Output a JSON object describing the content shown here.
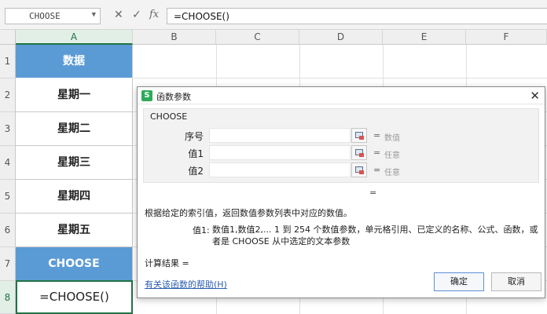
{
  "formula_bar": {
    "name_box": "CHOOSE",
    "cancel_icon": "✕",
    "enter_icon": "✓",
    "fx_label": "fx",
    "formula": "=CHOOSE()"
  },
  "columns": [
    "A",
    "B",
    "C",
    "D",
    "E",
    "F"
  ],
  "rows": [
    "1",
    "2",
    "3",
    "4",
    "5",
    "6",
    "7",
    "8"
  ],
  "cells": {
    "a1": "数据",
    "a2": "星期一",
    "a3": "星期二",
    "a4": "星期三",
    "a5": "星期四",
    "a6": "星期五",
    "a7": "CHOOSE",
    "a8": "=CHOOSE()"
  },
  "colors": {
    "header_blue": "#5b9bd5",
    "selection_green": "#217346"
  },
  "dialog": {
    "app_icon": "S",
    "title": "函数参数",
    "close": "✕",
    "function_name": "CHOOSE",
    "args": [
      {
        "label": "序号",
        "value": "",
        "hint": "数值"
      },
      {
        "label": "值1",
        "value": "",
        "hint": "任意"
      },
      {
        "label": "值2",
        "value": "",
        "hint": "任意"
      }
    ],
    "equals": "=",
    "result_equals": "=",
    "description": "根据给定的索引值，返回数值参数列表中对应的数值。",
    "arg_name": "值1:",
    "arg_desc": "数值1,数值2,... 1 到 254 个数值参数，单元格引用、已定义的名称、公式、函数，或者是 CHOOSE 从中选定的文本参数",
    "calc_result": "计算结果 =",
    "help_link": "有关该函数的帮助(H)",
    "ok": "确定",
    "cancel": "取消"
  }
}
